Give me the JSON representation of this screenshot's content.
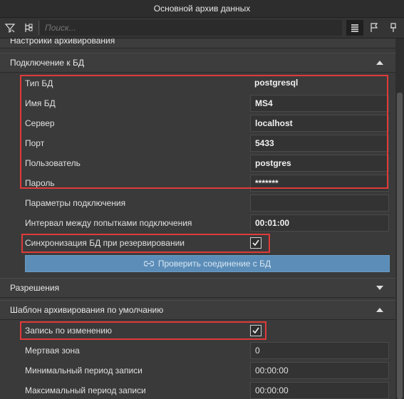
{
  "window": {
    "title": "Основной архив данных"
  },
  "toolbar": {
    "search_placeholder": "Поиск..."
  },
  "sections": {
    "archiving_settings": "Настройки архивирования",
    "db_connection": "Подключение к БД",
    "permissions": "Разрешения",
    "default_template": "Шаблон архивирования по умолчанию"
  },
  "db": {
    "type_label": "Тип БД",
    "type_value": "postgresql",
    "name_label": "Имя БД",
    "name_value": "MS4",
    "server_label": "Сервер",
    "server_value": "localhost",
    "port_label": "Порт",
    "port_value": "5433",
    "user_label": "Пользователь",
    "user_value": "postgres",
    "password_label": "Пароль",
    "password_value": "*******",
    "params_label": "Параметры подключения",
    "params_value": "",
    "interval_label": "Интервал между попытками подключения",
    "interval_value": "00:01:00",
    "sync_label": "Синхронизация БД при резервировании",
    "sync_checked": true,
    "verify_button": "Проверить соединение с БД"
  },
  "template": {
    "record_on_change_label": "Запись по изменению",
    "record_on_change_checked": true,
    "dead_zone_label": "Мертвая зона",
    "dead_zone_value": "0",
    "min_period_label": "Минимальный период записи",
    "min_period_value": "00:00:00",
    "max_period_label": "Максимальный период записи",
    "max_period_value": "00:00:00"
  },
  "colors": {
    "highlight": "#e03a3a",
    "accent_button": "#5b8db8"
  }
}
